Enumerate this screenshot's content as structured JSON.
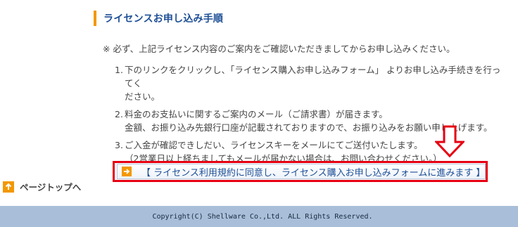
{
  "section": {
    "heading": "ライセンスお申し込み手順"
  },
  "notice": "※ 必ず、上記ライセンス内容のご案内をご確認いただきましてからお申し込みください。",
  "steps": [
    {
      "num": "1.",
      "lines": [
        "下のリンクをクリックし、「ライセンス購入お申し込みフォーム」 よりお申し込み手続きを行ってく",
        "ださい。"
      ]
    },
    {
      "num": "2.",
      "lines": [
        "料金のお支払いに関するご案内のメール（ご請求書）が届きます。",
        "金額、お振り込み先銀行口座が記載されておりますので、お振り込みをお願い申し上げます。"
      ]
    },
    {
      "num": "3.",
      "lines": [
        "ご入金が確認できしだい、ライセンスキーをメールにてご送付いたします。",
        "（2営業日以上経ちましてもメールが届かない場合は、お問い合わせください。）"
      ]
    }
  ],
  "cta": {
    "label": "【 ライセンス利用規約に同意し、ライセンス購入お申し込みフォームに進みます 】",
    "icon": "arrow-right-icon"
  },
  "page_top": {
    "label": "ページトップへ",
    "icon": "arrow-up-icon"
  },
  "footer": {
    "copyright": "Copyright(C) Shellware Co.,Ltd. ALL Rights Reserved."
  },
  "colors": {
    "accent_orange": "#f39800",
    "heading_blue": "#1e4f96",
    "highlight_red": "#e60012",
    "footer_bg": "#a9bfd9"
  }
}
